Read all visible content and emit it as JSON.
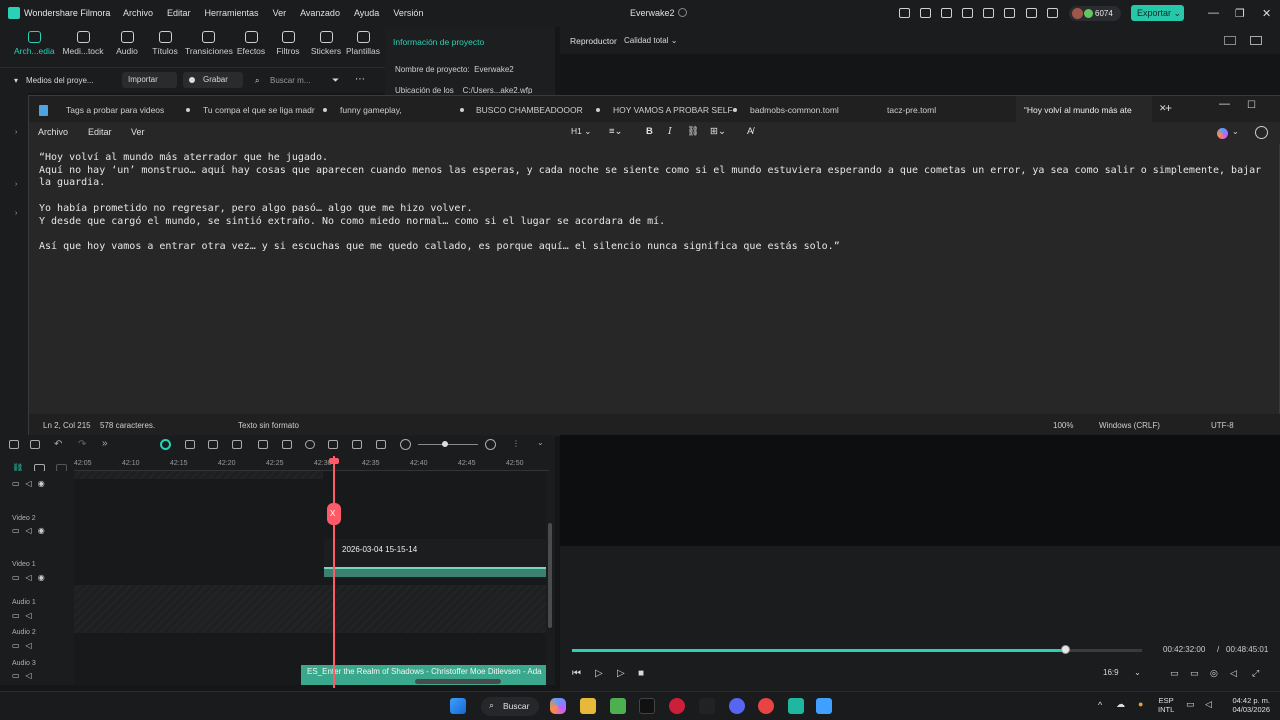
{
  "filmora": {
    "app_name": "Wondershare Filmora",
    "menu": [
      "Archivo",
      "Editar",
      "Herramientas",
      "Ver",
      "Avanzado",
      "Ayuda",
      "Versión"
    ],
    "project_name": "Everwake2",
    "credits": "6074",
    "export_label": "Exportar",
    "toolbar": [
      {
        "label": "Arch...edia",
        "icon": "media-icon",
        "active": true
      },
      {
        "label": "Medi...tock",
        "icon": "stock-icon",
        "active": false
      },
      {
        "label": "Audio",
        "icon": "music-icon",
        "active": false
      },
      {
        "label": "Títulos",
        "icon": "title-icon",
        "active": false
      },
      {
        "label": "Transiciones",
        "icon": "transition-icon",
        "active": false
      },
      {
        "label": "Efectos",
        "icon": "effects-icon",
        "active": false
      },
      {
        "label": "Filtros",
        "icon": "filter-icon",
        "active": false
      },
      {
        "label": "Stickers",
        "icon": "sticker-icon",
        "active": false
      },
      {
        "label": "Plantillas",
        "icon": "template-icon",
        "active": false
      }
    ],
    "subbar": {
      "media_label": "Medios del proye...",
      "import_label": "Importar",
      "record_label": "Grabar",
      "search_placeholder": "Buscar m..."
    },
    "project_info": {
      "header": "Información de proyecto",
      "name_label": "Nombre de proyecto:",
      "name_value": "Everwake2",
      "location_label": "Ubicación de los",
      "location_value": "C:/Users...ake2.wfp"
    },
    "player": {
      "label": "Reproductor",
      "quality": "Calidad total",
      "current_time": "00:42:32:00",
      "separator": "/",
      "total_time": "00:48:45:01",
      "progress": 0.865,
      "aspect": "16:9"
    },
    "timeline": {
      "ticks": [
        "42:05",
        "42:10",
        "42:15",
        "42:20",
        "42:25",
        "42:30",
        "42:35",
        "42:40",
        "42:45",
        "42:50"
      ],
      "tracks": [
        "Video 2",
        "Video 1",
        "Audio 1",
        "Audio 2",
        "Audio 3"
      ],
      "video_clip_title": "2026-03-04 15-15-14",
      "audio_clip_title": "ES_Enter the Realm of Shadows - Christoffer Moe Ditlevsen - Ada",
      "playhead_marker": "X"
    }
  },
  "notepad": {
    "tabs": [
      "Tags a probar para videos",
      "Tu compa el que se liga madr",
      "funny gameplay,",
      "BUSCO CHAMBEADOOOR",
      "HOY VAMOS A PROBAR SELF-",
      "badmobs-common.toml",
      "tacz-pre.toml",
      "“Hoy volví al mundo más ate"
    ],
    "new_tab": "+",
    "menu": [
      "Archivo",
      "Editar",
      "Ver"
    ],
    "heading_select": "H1",
    "content": "“Hoy volví al mundo más aterrador que he jugado.\nAquí no hay ‘un’ monstruo… aquí hay cosas que aparecen cuando menos las esperas, y cada noche se siente como si el mundo estuviera esperando a que cometas un error, ya sea como salir o simplemente, bajar la guardia.\n\nYo había prometido no regresar, pero algo pasó… algo que me hizo volver.\nY desde que cargó el mundo, se sintió extraño. No como miedo normal… como si el lugar se acordara de mí.\n\nAsí que hoy vamos a entrar otra vez… y si escuchas que me quedo callado, es porque aquí… el silencio nunca significa que estás solo.”",
    "status": {
      "position": "Ln 2, Col 215",
      "chars": "578 caracteres.",
      "format": "Texto sin formato",
      "zoom": "100%",
      "eol": "Windows (CRLF)",
      "encoding": "UTF-8"
    }
  },
  "taskbar": {
    "search": "Buscar",
    "lang": "ESP",
    "layout": "INTL",
    "time": "04:42 p. m.",
    "date": "04/03/2026"
  },
  "colors": {
    "accent": "#2ad1b7",
    "playhead": "#ff5a67",
    "audio_clip": "#3aa88d"
  }
}
